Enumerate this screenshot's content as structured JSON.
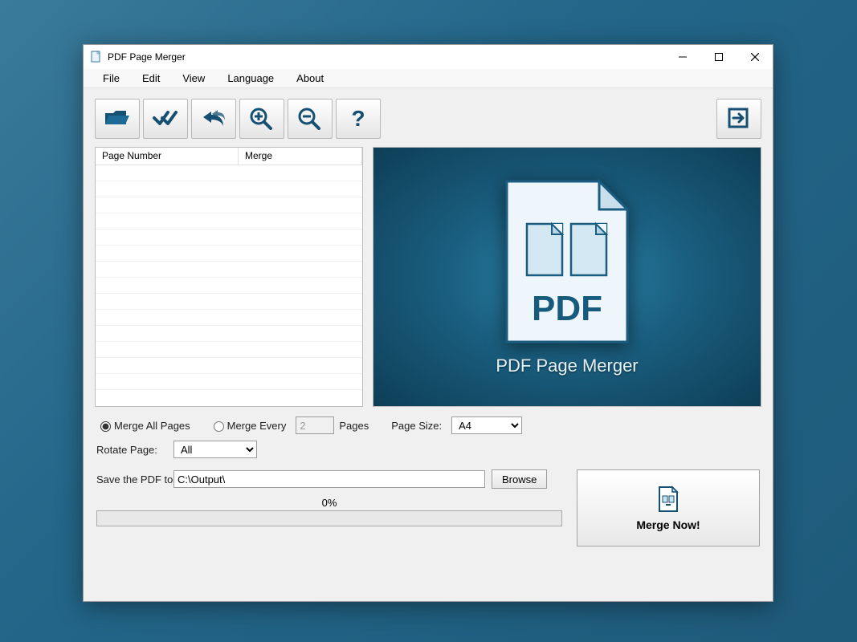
{
  "window": {
    "title": "PDF Page Merger"
  },
  "menu": {
    "file": "File",
    "edit": "Edit",
    "view": "View",
    "language": "Language",
    "about": "About"
  },
  "grid": {
    "col_page": "Page Number",
    "col_merge": "Merge"
  },
  "preview": {
    "title": "PDF Page Merger",
    "doc_label": "PDF"
  },
  "options": {
    "merge_all": "Merge All Pages",
    "merge_every": "Merge Every",
    "merge_every_n": "2",
    "pages_suffix": "Pages",
    "page_size_label": "Page Size:",
    "page_size_value": "A4",
    "rotate_label": "Rotate Page:",
    "rotate_value": "All",
    "save_label": "Save the PDF to",
    "save_path": "C:\\Output\\",
    "browse": "Browse"
  },
  "progress": {
    "percent_label": "0%"
  },
  "actions": {
    "merge_now": "Merge Now!"
  }
}
